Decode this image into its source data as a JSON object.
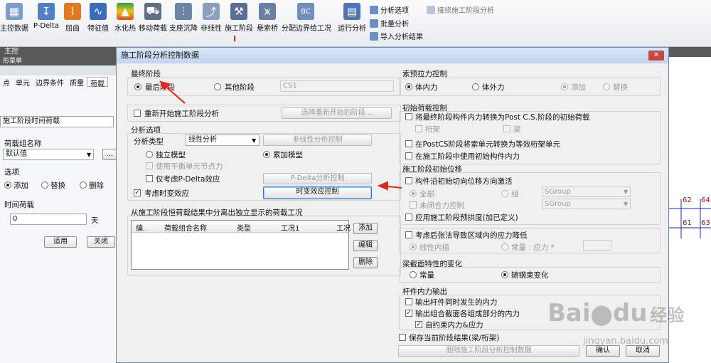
{
  "ribbon": {
    "items": [
      {
        "label": "主控数据",
        "icon": "master-data-icon"
      },
      {
        "label": "P-Delta",
        "icon": "pdelta-icon"
      },
      {
        "label": "屈曲",
        "icon": "buckling-icon"
      },
      {
        "label": "特征值",
        "icon": "eigenvalue-icon"
      },
      {
        "label": "水化热",
        "icon": "heat-hydration-icon"
      },
      {
        "label": "移动荷载",
        "icon": "moving-load-icon"
      },
      {
        "label": "支座沉降",
        "icon": "settlement-icon"
      },
      {
        "label": "非线性",
        "icon": "nonlinear-icon"
      },
      {
        "label": "施工阶段",
        "icon": "construction-stage-icon"
      },
      {
        "label": "悬索桥",
        "icon": "suspension-bridge-icon"
      },
      {
        "label": "分配边界给工况",
        "icon": "boundary-icon"
      },
      {
        "label": "运行分析",
        "icon": "run-analysis-icon"
      }
    ],
    "small": {
      "analysis_options": "分析选项",
      "batch_analysis": "批量分析",
      "import_results": "导入分析结果",
      "continue_stage": "接续施工阶段分析"
    },
    "group_label": "主控",
    "bc_badge": "BC"
  },
  "left": {
    "panel_title": "形菜单",
    "tabs": [
      "点",
      "单元",
      "边界条件",
      "质量",
      "荷载"
    ],
    "combo_value": "施工阶段时间荷载",
    "load_group_label": "荷载组名称",
    "load_group_value": "默认值",
    "ellipsis": "...",
    "options_label": "选项",
    "opt_add": "添加",
    "opt_replace": "替换",
    "opt_delete": "删除",
    "time_load_label": "时间荷载",
    "time_value": "0",
    "unit": "天",
    "apply": "适用",
    "close": "关闭"
  },
  "canvas": {
    "nodes": [
      "62",
      "64",
      "61",
      "63"
    ]
  },
  "dialog": {
    "title": "施工阶段分析控制数据",
    "final_stage": {
      "title": "最终阶段",
      "last": "最后阶段",
      "other": "其他阶段",
      "stage_value": "CS1"
    },
    "restart": {
      "label": "重新开始施工阶段分析",
      "select_btn": "选择重新开始的阶段..."
    },
    "analysis": {
      "title": "分析选项",
      "type_label": "分析类型",
      "type_value": "线性分析",
      "nonlinear_btn": "非线性分析控制",
      "independent": "独立模型",
      "cumulative": "累加模型",
      "balance": "使用平衡单元节点力",
      "pdelta": "仅考虑P-Delta效应",
      "pdelta_btn": "P-Delta分析控制",
      "timedep": "考虑时变效应",
      "timedep_btn": "时变效应控制"
    },
    "separate": {
      "title": "从施工阶段恒荷载结果中分离出独立显示的荷载工况",
      "cols": [
        "编.",
        "荷载组合名称",
        "类型",
        "工况1",
        "工况"
      ],
      "add": "添加",
      "edit": "编辑",
      "delete": "删除"
    },
    "cable": {
      "title": "索预拉力控制",
      "internal": "体内力",
      "external": "体外力",
      "add": "添加",
      "replace": "替换"
    },
    "initial_load": {
      "title": "初始荷载控制",
      "convert": "将最终阶段构件内力转换为Post C.S.阶段的初始荷载",
      "truss": "桁架",
      "beam": "梁",
      "postcs": "在PostCS阶段将索单元转换为等效桁架单元",
      "use_initial": "在施工阶段中使用初始构件内力"
    },
    "initial_disp": {
      "title": "施工阶段初始位移",
      "tangent": "构件沿初始切向位移方向激活",
      "all": "全部",
      "group": "组",
      "group_value": "SGroup",
      "unclosed": "未闭合力控制",
      "unclosed_value": "SGroup",
      "camber": "应用施工阶段预拱度(加已定义)"
    },
    "prestress": {
      "label": "考虑后张法导致区域内的应力降低",
      "linear": "线性内插",
      "constant": "常量 : 应力 *",
      "value": ""
    },
    "section": {
      "title": "梁截面特性的变化",
      "constant": "常量",
      "tendon": "随钢束变化"
    },
    "member": {
      "title": "杆件内力输出",
      "concurrent": "输出杆件同时发生的内力",
      "components": "输出组合截面各组成部分的内力",
      "self": "自约束内力&应力"
    },
    "save_current": "保存当前阶段结果(梁/桁架)",
    "delete_btn": "删除施工阶段分析控制数据",
    "ok": "确认",
    "cancel": "取消"
  },
  "watermark": {
    "brand": "Bai",
    "du": "du",
    "jingyan": "经验",
    "url": "jingyan.baidu.com"
  },
  "colors": {
    "arrow": "#e8231f",
    "title_bar": "#c2d5ee",
    "canvas_line": "#1a24c6"
  }
}
